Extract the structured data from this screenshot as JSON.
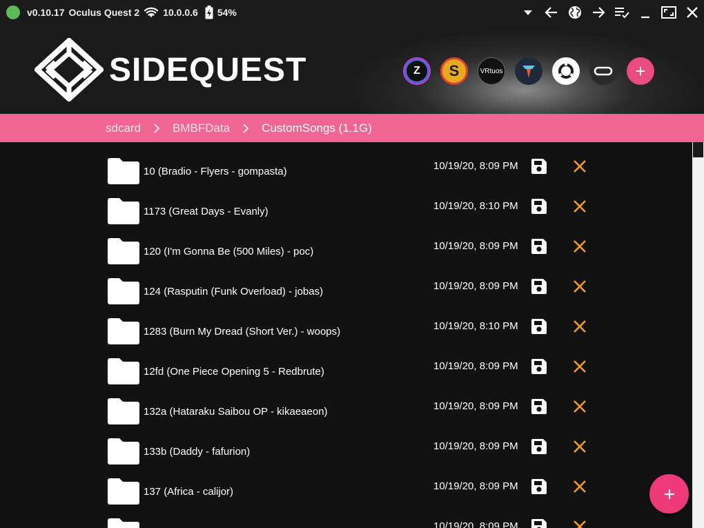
{
  "topbar": {
    "status_color": "#5cb85c",
    "version": "v0.10.17",
    "device": "Oculus Quest 2",
    "ip": "10.0.0.6",
    "battery": "54%",
    "icons": [
      "chevron-down-icon",
      "back-arrow-icon",
      "globe-icon",
      "forward-arrow-icon",
      "queue-list-icon",
      "minimize-icon",
      "maximize-icon",
      "close-icon"
    ]
  },
  "header": {
    "logo_text": "SIDEQUEST",
    "apps": [
      {
        "name": "zenith-app-icon",
        "label": "Z"
      },
      {
        "name": "sidequest-s-app-icon",
        "label": "S"
      },
      {
        "name": "vrtuos-app-icon",
        "label": "VRtuos"
      },
      {
        "name": "trinity-app-icon",
        "label": ""
      },
      {
        "name": "ring-app-icon",
        "label": ""
      },
      {
        "name": "oculus-app-icon",
        "label": ""
      },
      {
        "name": "add-app-icon",
        "label": "+"
      }
    ]
  },
  "breadcrumb": [
    "sdcard",
    "BMBFData",
    "CustomSongs (1.1G)"
  ],
  "files": [
    {
      "name": "10 (Bradio - Flyers - gompasta)",
      "date": "10/19/20, 8:09 PM"
    },
    {
      "name": "1173 (Great Days - Evanly)",
      "date": "10/19/20, 8:10 PM"
    },
    {
      "name": "120 (I'm Gonna Be (500 Miles) - poc)",
      "date": "10/19/20, 8:09 PM"
    },
    {
      "name": "124 (Rasputin (Funk Overload) - jobas)",
      "date": "10/19/20, 8:09 PM"
    },
    {
      "name": "1283 (Burn My Dread (Short Ver.) - woops)",
      "date": "10/19/20, 8:10 PM"
    },
    {
      "name": "12fd (One Piece Opening 5 - Redbrute)",
      "date": "10/19/20, 8:09 PM"
    },
    {
      "name": "132a (Hataraku Saibou OP - kikaeaeon)",
      "date": "10/19/20, 8:09 PM"
    },
    {
      "name": "133b (Daddy - fafurion)",
      "date": "10/19/20, 8:09 PM"
    },
    {
      "name": "137 (Africa - calijor)",
      "date": "10/19/20, 8:09 PM"
    },
    {
      "name": "",
      "date": "10/19/20, 8:09 PM"
    }
  ],
  "colors": {
    "accent": "#f06592",
    "delete": "#f39c2b",
    "fab": "#ee3a78"
  },
  "fab_label": "+"
}
